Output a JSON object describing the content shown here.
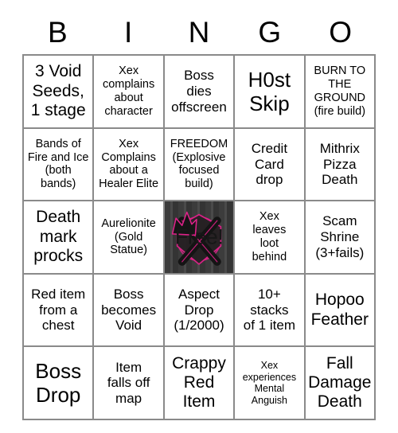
{
  "header": {
    "letters": [
      "B",
      "I",
      "N",
      "G",
      "O"
    ]
  },
  "theme": {
    "page_background": "#ffffff",
    "grid_line": "#8a8a8a",
    "text": "#000000",
    "free_background": "#3b3b3b",
    "free_accent": "#e0218a",
    "free_label_color": "#171717"
  },
  "grid": {
    "columns": 5,
    "rows": 5,
    "cells": [
      {
        "text": "3 Void Seeds,\n1 stage",
        "size": "lg",
        "free": false
      },
      {
        "text": "Xex\ncomplains\nabout\ncharacter",
        "size": "sm",
        "free": false
      },
      {
        "text": "Boss\ndies\noffscreen",
        "size": "md",
        "free": false
      },
      {
        "text": "H0st\nSkip",
        "size": "xl",
        "free": false
      },
      {
        "text": "BURN TO\nTHE\nGROUND\n(fire build)",
        "size": "sm",
        "free": false
      },
      {
        "text": "Bands of\nFire and Ice\n(both\nbands)",
        "size": "sm",
        "free": false
      },
      {
        "text": "Xex\nComplains\nabout a\nHealer Elite",
        "size": "sm",
        "free": false
      },
      {
        "text": "FREEDOM\n(Explosive\nfocused\nbuild)",
        "size": "sm",
        "free": false
      },
      {
        "text": "Credit\nCard\ndrop",
        "size": "md",
        "free": false
      },
      {
        "text": "Mithrix\nPizza\nDeath",
        "size": "md",
        "free": false
      },
      {
        "text": "Death\nmark\nprocks",
        "size": "lg",
        "free": false
      },
      {
        "text": "Aurelionite\n(Gold\nStatue)",
        "size": "sm",
        "free": false
      },
      {
        "text": "Free!",
        "size": "lg",
        "free": true,
        "icon": "crowned-x-emblem"
      },
      {
        "text": "Xex\nleaves\nloot\nbehind",
        "size": "sm",
        "free": false
      },
      {
        "text": "Scam\nShrine\n(3+fails)",
        "size": "md",
        "free": false
      },
      {
        "text": "Red item\nfrom a\nchest",
        "size": "md",
        "free": false
      },
      {
        "text": "Boss\nbecomes\nVoid",
        "size": "md",
        "free": false
      },
      {
        "text": "Aspect\nDrop\n(1/2000)",
        "size": "md",
        "free": false
      },
      {
        "text": "10+\nstacks\nof 1 item",
        "size": "md",
        "free": false
      },
      {
        "text": "Hopoo\nFeather",
        "size": "lg",
        "free": false
      },
      {
        "text": "Boss\nDrop",
        "size": "xl",
        "free": false
      },
      {
        "text": "Item\nfalls off\nmap",
        "size": "md",
        "free": false
      },
      {
        "text": "Crappy\nRed\nItem",
        "size": "lg",
        "free": false
      },
      {
        "text": "Xex\nexperiences\nMental\nAnguish",
        "size": "xs",
        "free": false
      },
      {
        "text": "Fall\nDamage\nDeath",
        "size": "lg",
        "free": false
      }
    ]
  }
}
